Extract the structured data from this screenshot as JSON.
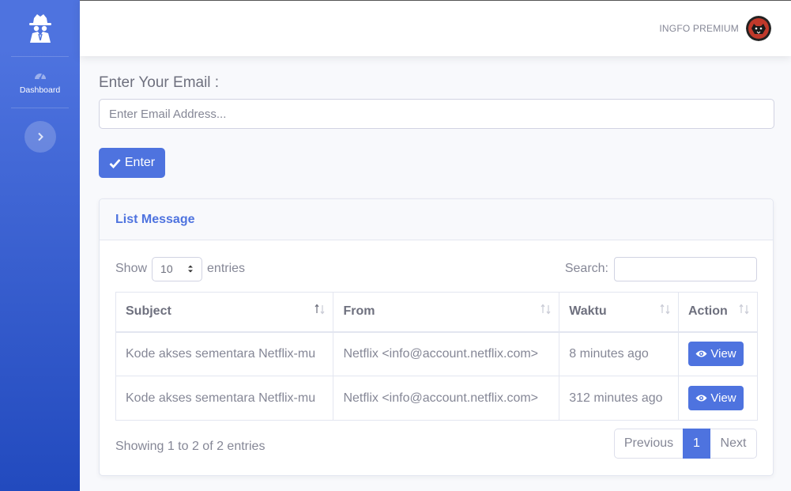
{
  "sidebar": {
    "brand_icon": "incognito-icon",
    "items": [
      {
        "label": "Dashboard",
        "icon": "tachometer-icon"
      }
    ],
    "toggle_icon": "chevron-right-icon"
  },
  "topbar": {
    "user_name": "INGFO PREMIUM",
    "avatar_icon": "avatar-bear-icon"
  },
  "form": {
    "email_label": "Enter Your Email :",
    "email_placeholder": "Enter Email Address...",
    "email_value": "",
    "enter_label": "Enter",
    "enter_icon": "check-icon"
  },
  "card": {
    "title": "List Message",
    "show_label": "Show",
    "entries_value": "10",
    "entries_label": "entries",
    "search_label": "Search:",
    "columns": [
      "Subject",
      "From",
      "Waktu",
      "Action"
    ],
    "rows": [
      {
        "subject": "Kode akses sementara Netflix-mu",
        "from": "Netflix <info@account.netflix.com>",
        "waktu": "8 minutes ago",
        "action": "View"
      },
      {
        "subject": "Kode akses sementara Netflix-mu",
        "from": "Netflix <info@account.netflix.com>",
        "waktu": "312 minutes ago",
        "action": "View"
      }
    ],
    "info": "Showing 1 to 2 of 2 entries",
    "pagination": {
      "previous": "Previous",
      "current": "1",
      "next": "Next"
    }
  },
  "colors": {
    "primary": "#4e73df",
    "sidebar_bottom": "#224abe",
    "text": "#858796",
    "border": "#e3e6f0"
  }
}
